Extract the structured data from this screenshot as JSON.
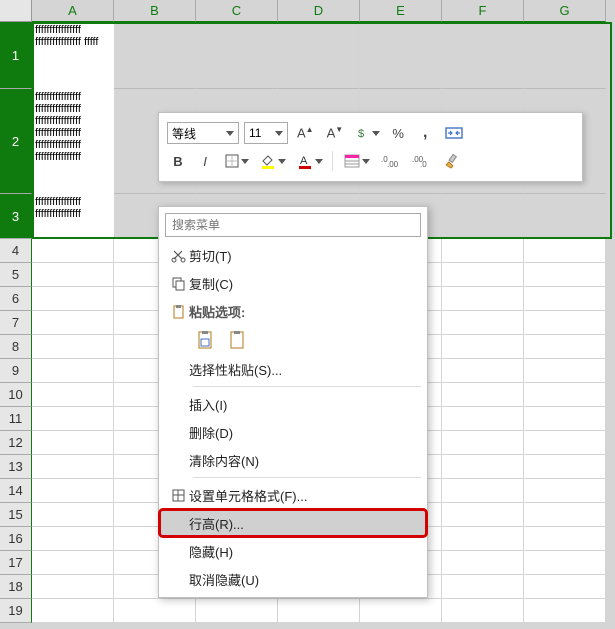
{
  "columns": [
    "A",
    "B",
    "C",
    "D",
    "E",
    "F",
    "G"
  ],
  "selected_rows": [
    1,
    2,
    3
  ],
  "rows": [
    {
      "num": 1,
      "tall": "r1",
      "a": "ffffffffffffffff ffffffffffffffff fffff"
    },
    {
      "num": 2,
      "tall": "r2",
      "a": "ffffffffffffffff ffffffffffffffff ffffffffffffffff ffffffffffffffff ffffffffffffffff ffffffffffffffff"
    },
    {
      "num": 3,
      "tall": "r3",
      "a": "ffffffffffffffff ffffffffffffffff"
    },
    {
      "num": 4
    },
    {
      "num": 5
    },
    {
      "num": 6
    },
    {
      "num": 7
    },
    {
      "num": 8
    },
    {
      "num": 9
    },
    {
      "num": 10
    },
    {
      "num": 11
    },
    {
      "num": 12
    },
    {
      "num": 13
    },
    {
      "num": 14
    },
    {
      "num": 15
    },
    {
      "num": 16
    },
    {
      "num": 17
    },
    {
      "num": 18
    },
    {
      "num": 19
    }
  ],
  "mini_toolbar": {
    "font_name": "等线",
    "font_size": "11"
  },
  "context_menu": {
    "search_placeholder": "搜索菜单",
    "cut": "剪切(T)",
    "copy": "复制(C)",
    "paste_header": "粘贴选项:",
    "paste_special": "选择性粘贴(S)...",
    "insert": "插入(I)",
    "delete": "删除(D)",
    "clear": "清除内容(N)",
    "format": "设置单元格格式(F)...",
    "row_height": "行高(R)...",
    "hide": "隐藏(H)",
    "unhide": "取消隐藏(U)"
  }
}
